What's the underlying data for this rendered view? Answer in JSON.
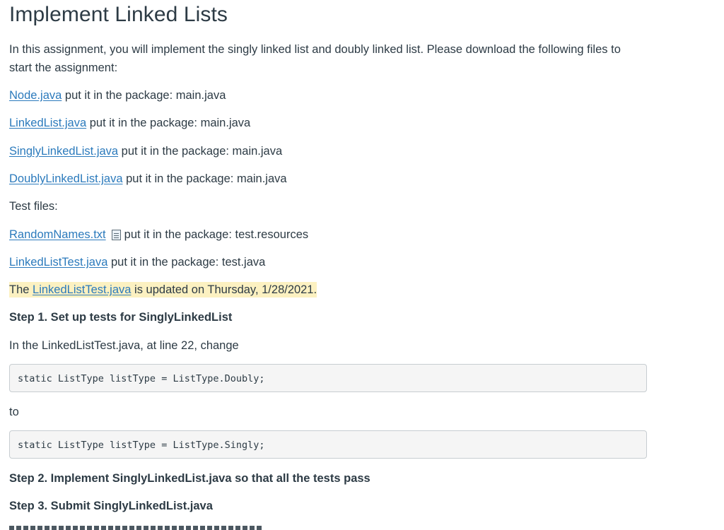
{
  "title": "Implement Linked Lists",
  "intro": "In this assignment, you will implement the singly linked list and doubly linked list. Please download the following files to start the assignment:",
  "files": [
    {
      "link": "Node.java",
      "text": " put it in the package: main.java"
    },
    {
      "link": "LinkedList.java",
      "text": " put it in the package: main.java"
    },
    {
      "link": "SinglyLinkedList.java",
      "text": " put it in the package: main.java"
    },
    {
      "link": "DoublyLinkedList.java",
      "text": " put it in the package: main.java"
    }
  ],
  "test_files_label": "Test files:",
  "test_files": [
    {
      "link": "RandomNames.txt",
      "icon": "file-preview-icon",
      "text": "put it in the package: test.resources"
    },
    {
      "link": "LinkedListTest.java",
      "text": " put it in the package: test.java"
    }
  ],
  "update_note": {
    "prefix": "The ",
    "link": "LinkedListTest.java",
    "suffix": " is updated on Thursday, 1/28/2021."
  },
  "step1_heading": "Step 1. Set up tests for SinglyLinkedList",
  "step1_text": "In the LinkedListTest.java, at line 22, change",
  "code_before": "static ListType listType = ListType.Doubly;",
  "to_label": "to",
  "code_after": "static ListType listType = ListType.Singly;",
  "step2_heading": "Step 2. Implement SinglyLinkedList.java so that all the tests pass",
  "step3_heading": "Step 3. Submit SinglyLinkedList.java"
}
